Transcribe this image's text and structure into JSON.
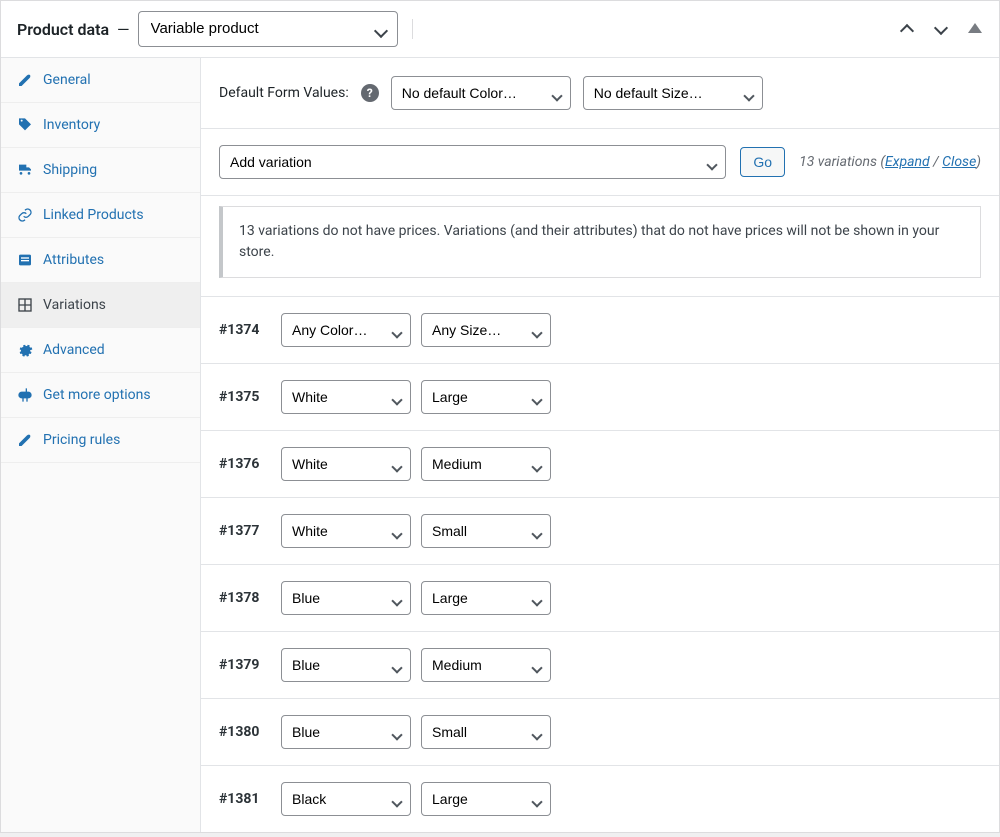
{
  "header": {
    "title": "Product data",
    "type_select": "Variable product"
  },
  "sidebar": {
    "items": [
      {
        "label": "General",
        "icon": "wrench-icon"
      },
      {
        "label": "Inventory",
        "icon": "tag-icon"
      },
      {
        "label": "Shipping",
        "icon": "truck-icon"
      },
      {
        "label": "Linked Products",
        "icon": "link-icon"
      },
      {
        "label": "Attributes",
        "icon": "list-icon"
      },
      {
        "label": "Variations",
        "icon": "grid-icon",
        "active": true
      },
      {
        "label": "Advanced",
        "icon": "gear-icon"
      },
      {
        "label": "Get more options",
        "icon": "plugin-icon"
      },
      {
        "label": "Pricing rules",
        "icon": "wrench-icon"
      }
    ]
  },
  "defaults": {
    "label": "Default Form Values:",
    "color_select": "No default Color…",
    "size_select": "No default Size…"
  },
  "action": {
    "add_select": "Add variation",
    "go_label": "Go",
    "count_prefix": "13 variations (",
    "expand_label": "Expand",
    "separator": " / ",
    "close_label": "Close",
    "count_suffix": ")"
  },
  "notice": {
    "text": "13 variations do not have prices. Variations (and their attributes) that do not have prices will not be shown in your store."
  },
  "variations": [
    {
      "id": "#1374",
      "color": "Any Color…",
      "size": "Any Size…"
    },
    {
      "id": "#1375",
      "color": "White",
      "size": "Large"
    },
    {
      "id": "#1376",
      "color": "White",
      "size": "Medium"
    },
    {
      "id": "#1377",
      "color": "White",
      "size": "Small"
    },
    {
      "id": "#1378",
      "color": "Blue",
      "size": "Large"
    },
    {
      "id": "#1379",
      "color": "Blue",
      "size": "Medium"
    },
    {
      "id": "#1380",
      "color": "Blue",
      "size": "Small"
    },
    {
      "id": "#1381",
      "color": "Black",
      "size": "Large"
    }
  ]
}
